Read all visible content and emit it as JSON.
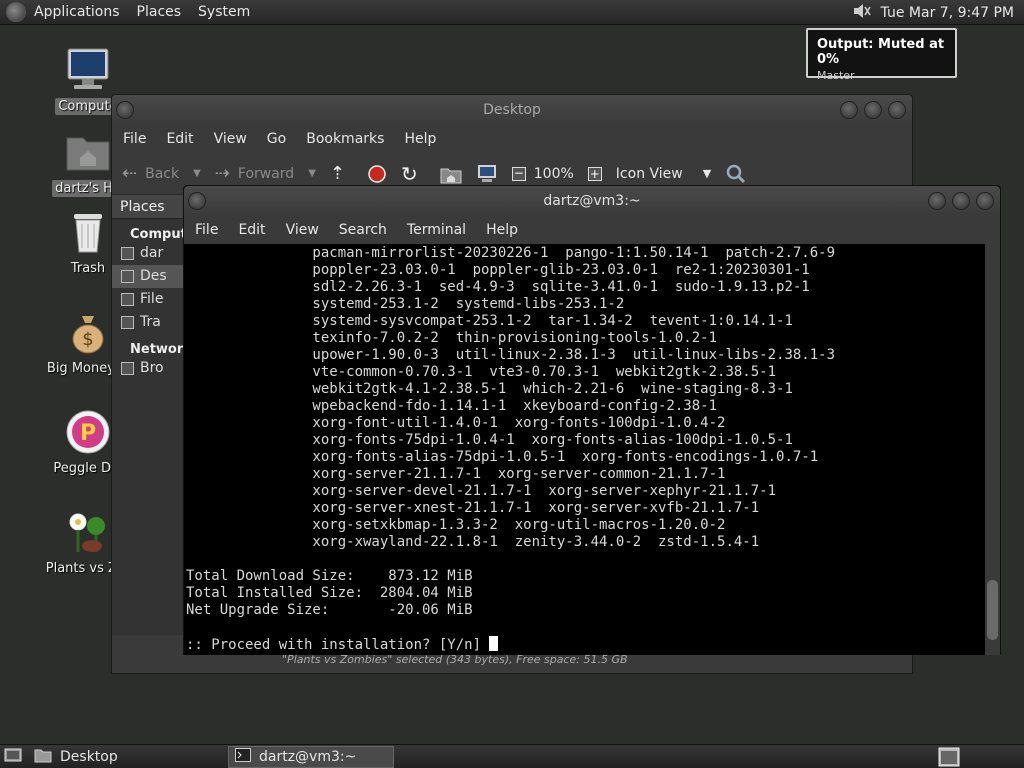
{
  "top_panel": {
    "menus": [
      "Applications",
      "Places",
      "System"
    ],
    "clock": "Tue Mar  7,  9:47 PM"
  },
  "notification": {
    "title": "Output: Muted at 0%",
    "subtitle": "Master"
  },
  "desktop_icons": [
    {
      "label": "Compute",
      "icon": "computer-icon",
      "selected": true
    },
    {
      "label": "dartz's Ho",
      "icon": "home-folder-icon",
      "selected": true
    },
    {
      "label": "Trash",
      "icon": "trash-icon",
      "selected": false
    },
    {
      "label": "Big Money D",
      "icon": "money-bag-icon",
      "selected": false
    },
    {
      "label": "Peggle Del",
      "icon": "peggle-icon",
      "selected": false
    },
    {
      "label": "Plants vs Zor",
      "icon": "plants-icon",
      "selected": false
    }
  ],
  "file_manager": {
    "title": "Desktop",
    "menus": [
      "File",
      "Edit",
      "View",
      "Go",
      "Bookmarks",
      "Help"
    ],
    "toolbar": {
      "back": "Back",
      "forward": "Forward",
      "zoom": "100%",
      "view_mode": "Icon View"
    },
    "sidebar": {
      "selector": "Places",
      "computer_header": "Comput",
      "items": [
        "dar",
        "Des",
        "File",
        "Tra"
      ],
      "network_header": "Network",
      "network_items": [
        "Bro"
      ]
    },
    "status": "\"Plants vs Zombies\" selected (343 bytes), Free space: 51.5 GB"
  },
  "terminal": {
    "title": "dartz@vm3:~",
    "menus": [
      "File",
      "Edit",
      "View",
      "Search",
      "Terminal",
      "Help"
    ],
    "lines": [
      "               pacman-mirrorlist-20230226-1  pango-1:1.50.14-1  patch-2.7.6-9",
      "               poppler-23.03.0-1  poppler-glib-23.03.0-1  re2-1:20230301-1",
      "               sdl2-2.26.3-1  sed-4.9-3  sqlite-3.41.0-1  sudo-1.9.13.p2-1",
      "               systemd-253.1-2  systemd-libs-253.1-2",
      "               systemd-sysvcompat-253.1-2  tar-1.34-2  tevent-1:0.14.1-1",
      "               texinfo-7.0.2-2  thin-provisioning-tools-1.0.2-1",
      "               upower-1.90.0-3  util-linux-2.38.1-3  util-linux-libs-2.38.1-3",
      "               vte-common-0.70.3-1  vte3-0.70.3-1  webkit2gtk-2.38.5-1",
      "               webkit2gtk-4.1-2.38.5-1  which-2.21-6  wine-staging-8.3-1",
      "               wpebackend-fdo-1.14.1-1  xkeyboard-config-2.38-1",
      "               xorg-font-util-1.4.0-1  xorg-fonts-100dpi-1.0.4-2",
      "               xorg-fonts-75dpi-1.0.4-1  xorg-fonts-alias-100dpi-1.0.5-1",
      "               xorg-fonts-alias-75dpi-1.0.5-1  xorg-fonts-encodings-1.0.7-1",
      "               xorg-server-21.1.7-1  xorg-server-common-21.1.7-1",
      "               xorg-server-devel-21.1.7-1  xorg-server-xephyr-21.1.7-1",
      "               xorg-server-xnest-21.1.7-1  xorg-server-xvfb-21.1.7-1",
      "               xorg-setxkbmap-1.3.3-2  xorg-util-macros-1.20.0-2",
      "               xorg-xwayland-22.1.8-1  zenity-3.44.0-2  zstd-1.5.4-1",
      "",
      "Total Download Size:    873.12 MiB",
      "Total Installed Size:  2804.04 MiB",
      "Net Upgrade Size:       -20.06 MiB",
      ""
    ],
    "prompt": ":: Proceed with installation? [Y/n] "
  },
  "bottom_panel": {
    "tasks": [
      {
        "label": "Desktop",
        "icon": "folder-icon",
        "active": false
      },
      {
        "label": "dartz@vm3:~",
        "icon": "terminal-icon",
        "active": true
      }
    ]
  }
}
